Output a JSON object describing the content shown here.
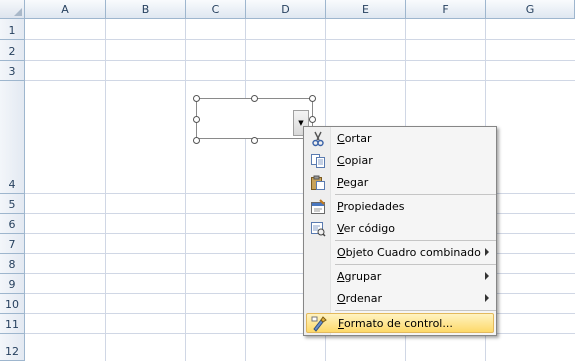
{
  "spreadsheet": {
    "columns": [
      "A",
      "B",
      "C",
      "D",
      "E",
      "F",
      "G"
    ],
    "rows": [
      "1",
      "2",
      "3",
      "4",
      "5",
      "6",
      "7",
      "8",
      "9",
      "10",
      "11",
      "12"
    ]
  },
  "combo_dropdown_glyph": "▼",
  "context_menu": {
    "items": [
      {
        "label": "Cortar",
        "icon": "scissors-icon"
      },
      {
        "label": "Copiar",
        "icon": "copy-icon"
      },
      {
        "label": "Pegar",
        "icon": "paste-icon"
      },
      {
        "label": "Propiedades",
        "icon": "properties-icon"
      },
      {
        "label": "Ver código",
        "icon": "view-code-icon"
      },
      {
        "label": "Objeto Cuadro combinado",
        "submenu": true
      },
      {
        "label": "Agrupar",
        "submenu": true
      },
      {
        "label": "Ordenar",
        "submenu": true
      },
      {
        "label": "Formato de control...",
        "icon": "format-control-icon",
        "highlighted": true
      }
    ]
  },
  "colors": {
    "grid": "#d0d7e5",
    "header_border": "#9eb6ce",
    "highlight": "#fdd96a"
  }
}
